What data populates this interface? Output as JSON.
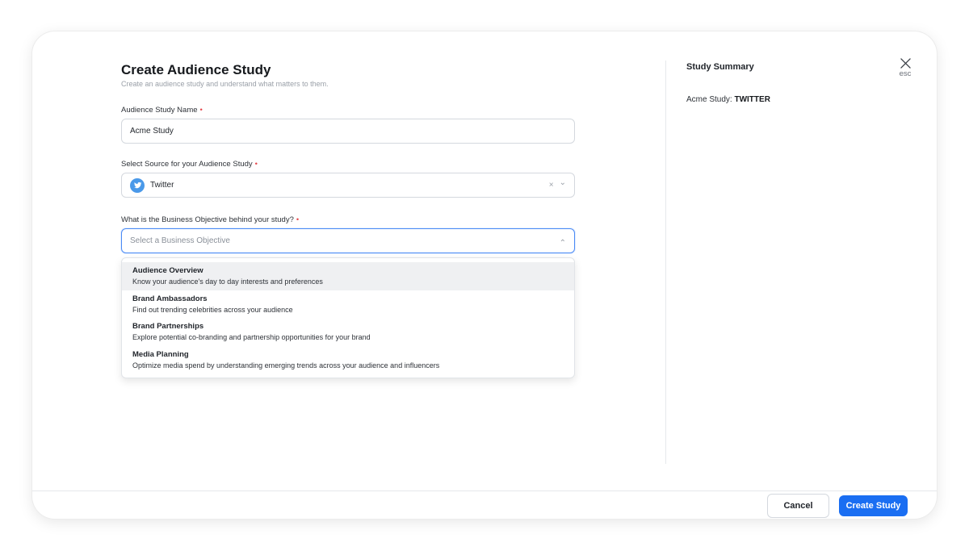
{
  "header": {
    "title": "Create Audience Study",
    "subtitle": "Create an audience study and understand what matters to them."
  },
  "form": {
    "name_field": {
      "label": "Audience Study Name",
      "required_mark": "•",
      "value": "Acme Study"
    },
    "source_field": {
      "label": "Select Source for your Audience Study",
      "required_mark": "•",
      "value": "Twitter",
      "icon": "twitter-icon",
      "clear_glyph": "×",
      "chevron_glyph": "⌄"
    },
    "objective_field": {
      "label": "What is the Business Objective behind your study?",
      "required_mark": "•",
      "placeholder": "Select a Business Objective",
      "chevron_glyph": "⌃"
    },
    "objective_options": [
      {
        "title": "Audience Overview",
        "description": "Know your audience's day to day interests and preferences"
      },
      {
        "title": "Brand Ambassadors",
        "description": "Find out trending celebrities across your audience"
      },
      {
        "title": "Brand Partnerships",
        "description": "Explore potential co-branding and partnership opportunities for your brand"
      },
      {
        "title": "Media Planning",
        "description": "Optimize media spend by understanding emerging trends across your audience and influencers"
      }
    ]
  },
  "summary": {
    "title": "Study Summary",
    "study_prefix": "Acme Study:",
    "study_source": "TWITTER"
  },
  "close": {
    "esc_label": "esc"
  },
  "footer": {
    "cancel_label": "Cancel",
    "create_label": "Create Study"
  },
  "colors": {
    "primary": "#1a6ef2",
    "required": "#e5484d",
    "twitter": "#4a99e9",
    "focus_border": "#4c8bf5"
  }
}
